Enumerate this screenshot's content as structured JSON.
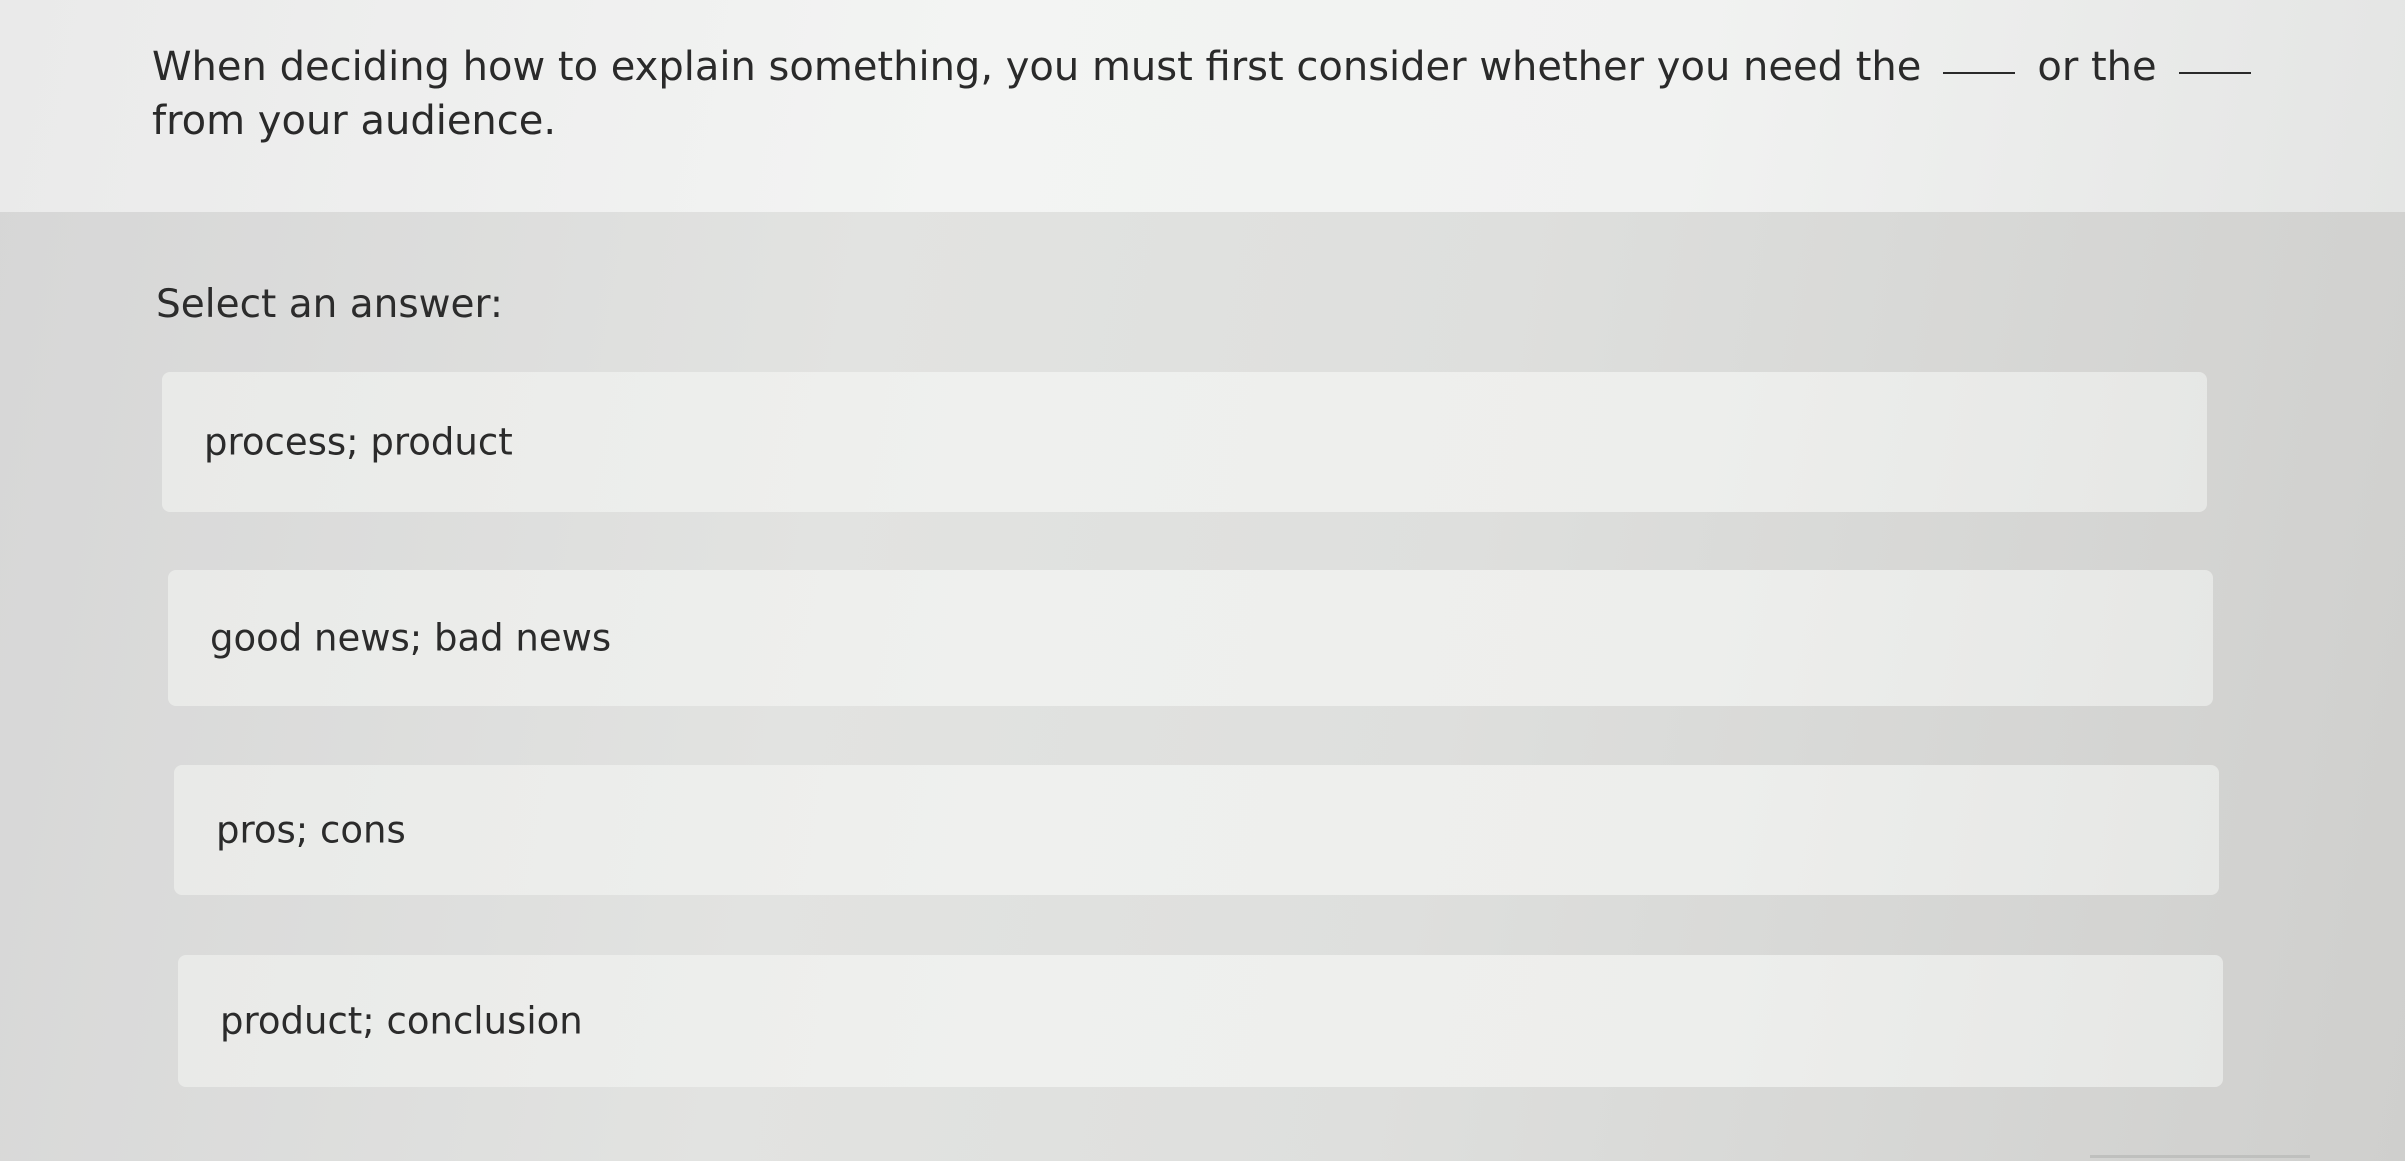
{
  "question": {
    "part1": "When deciding how to explain something, you must first consider whether you need the",
    "part2": "or the",
    "part3": "from your audience."
  },
  "prompt": "Select an answer:",
  "options": [
    {
      "label": "process; product"
    },
    {
      "label": "good news; bad news"
    },
    {
      "label": "pros; cons"
    },
    {
      "label": "product; conclusion"
    }
  ]
}
